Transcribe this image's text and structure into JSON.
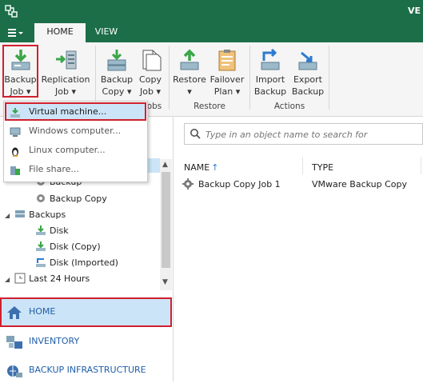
{
  "title_text": "VE",
  "tabs": [
    {
      "label": "HOME"
    },
    {
      "label": "VIEW"
    }
  ],
  "ribbon": {
    "buttons": [
      {
        "line1": "Backup",
        "line2": "Job"
      },
      {
        "line1": "Replication",
        "line2": "Job"
      },
      {
        "line1": "Backup",
        "line2": "Copy"
      },
      {
        "line1": "Copy",
        "line2": "Job"
      },
      {
        "line1": "Restore",
        "line2": ""
      },
      {
        "line1": "Failover",
        "line2": "Plan"
      },
      {
        "line1": "Import",
        "line2": "Backup"
      },
      {
        "line1": "Export",
        "line2": "Backup"
      }
    ],
    "groups": [
      {
        "label": "obs"
      },
      {
        "label": "Restore"
      },
      {
        "label": "Actions"
      }
    ],
    "dropdown_arrow": "▾"
  },
  "dropdown": {
    "items": [
      {
        "label": "Virtual machine...",
        "icon": "vm-icon"
      },
      {
        "label": "Windows computer...",
        "icon": "windows-computer-icon"
      },
      {
        "label": "Linux computer...",
        "icon": "linux-computer-icon"
      },
      {
        "label": "File share...",
        "icon": "file-share-icon"
      }
    ]
  },
  "tree": {
    "items": [
      {
        "label": "Backup"
      },
      {
        "label": "Backup Copy"
      },
      {
        "label": "Backups"
      },
      {
        "label": "Disk"
      },
      {
        "label": "Disk (Copy)"
      },
      {
        "label": "Disk (Imported)"
      },
      {
        "label": "Last 24 Hours"
      }
    ]
  },
  "nav": {
    "items": [
      {
        "label": "HOME"
      },
      {
        "label": "INVENTORY"
      },
      {
        "label": "BACKUP INFRASTRUCTURE"
      }
    ]
  },
  "search": {
    "placeholder": "Type in an object name to search for"
  },
  "table": {
    "columns": [
      {
        "label": "NAME"
      },
      {
        "label": "TYPE"
      }
    ],
    "sort_indicator": "↑",
    "rows": [
      {
        "name": "Backup Copy Job 1",
        "type": "VMware Backup Copy"
      }
    ]
  },
  "colors": {
    "brand_green": "#1c6e48",
    "highlight_red": "#d0202e",
    "selection_blue": "#cce4f7",
    "link_blue": "#1f5ea8"
  }
}
